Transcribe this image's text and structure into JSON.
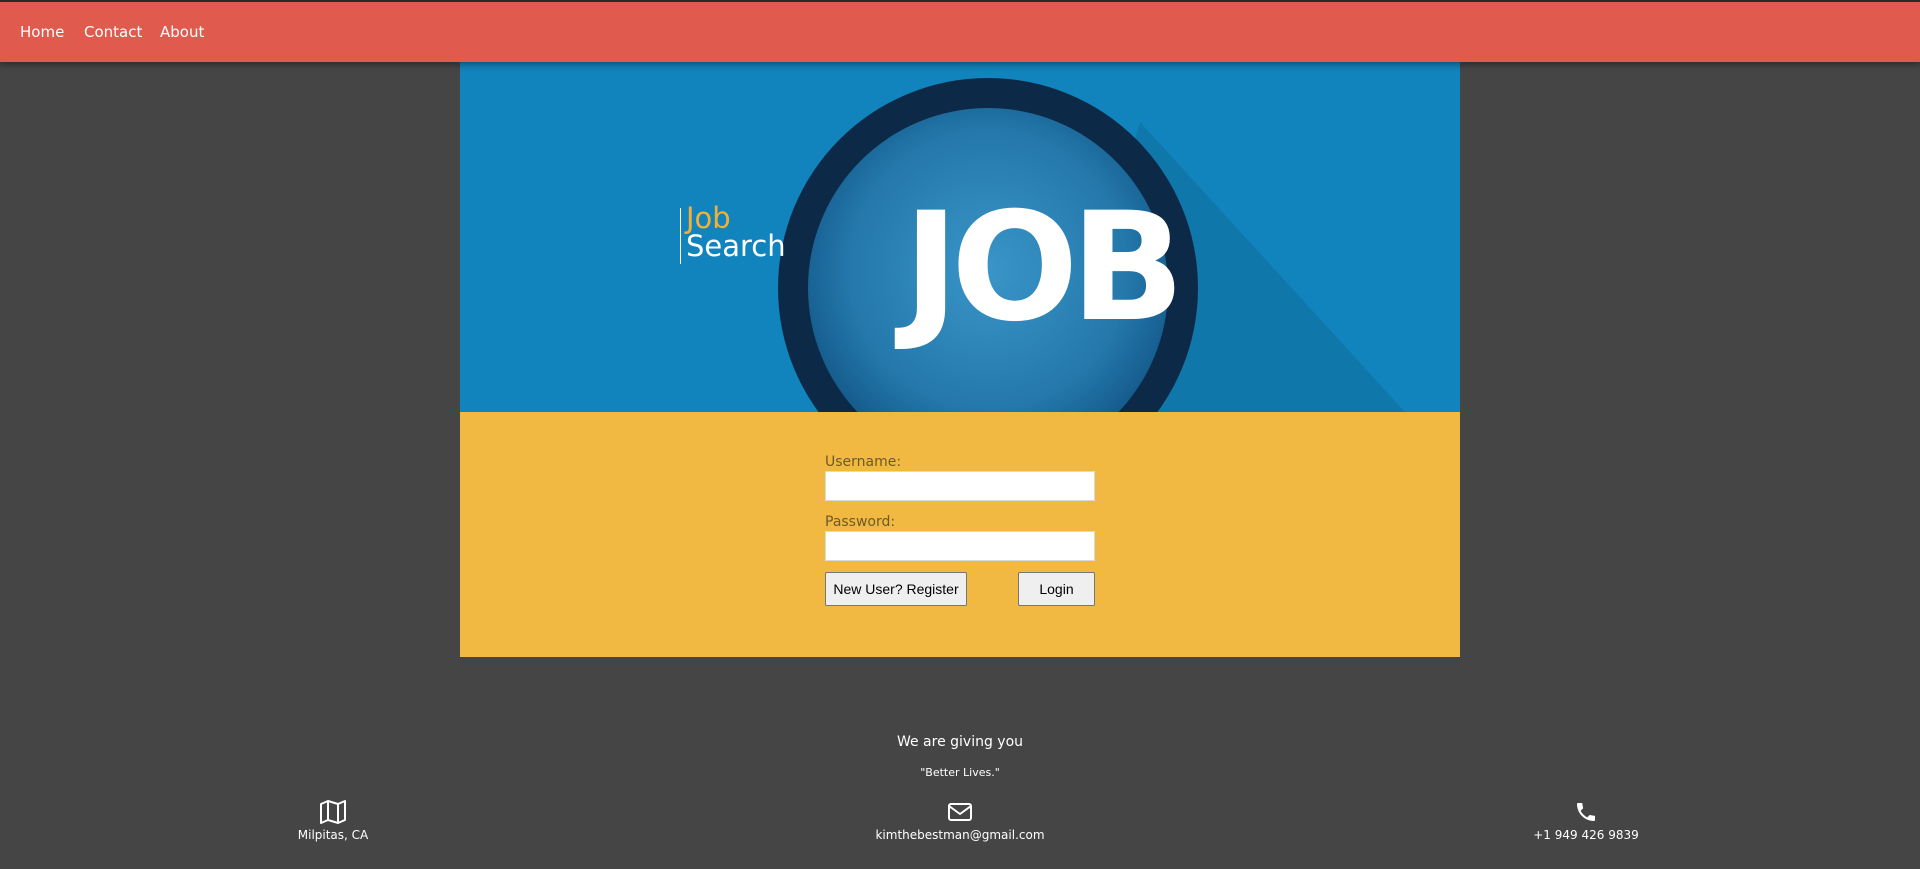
{
  "nav": {
    "items": [
      {
        "label": "Home"
      },
      {
        "label": "Contact"
      },
      {
        "label": "About"
      }
    ],
    "background_color": "#e05a4d"
  },
  "hero": {
    "logo_line1": "Job",
    "logo_line2": "Search",
    "banner_word": "JOB",
    "background_color": "#1284bd",
    "accent_color": "#f2b134"
  },
  "login": {
    "username_label": "Username:",
    "username_value": "",
    "password_label": "Password:",
    "password_value": "",
    "register_button": "New User? Register",
    "login_button": "Login",
    "background_color": "#f2b942"
  },
  "footer": {
    "tagline": "We are giving you",
    "motto": "\"Better Lives.\"",
    "contacts": [
      {
        "icon": "map-icon",
        "text": "Milpitas, CA"
      },
      {
        "icon": "envelope-icon",
        "text": "kimthebestman@gmail.com"
      },
      {
        "icon": "phone-icon",
        "text": "+1 949 426 9839"
      }
    ]
  }
}
